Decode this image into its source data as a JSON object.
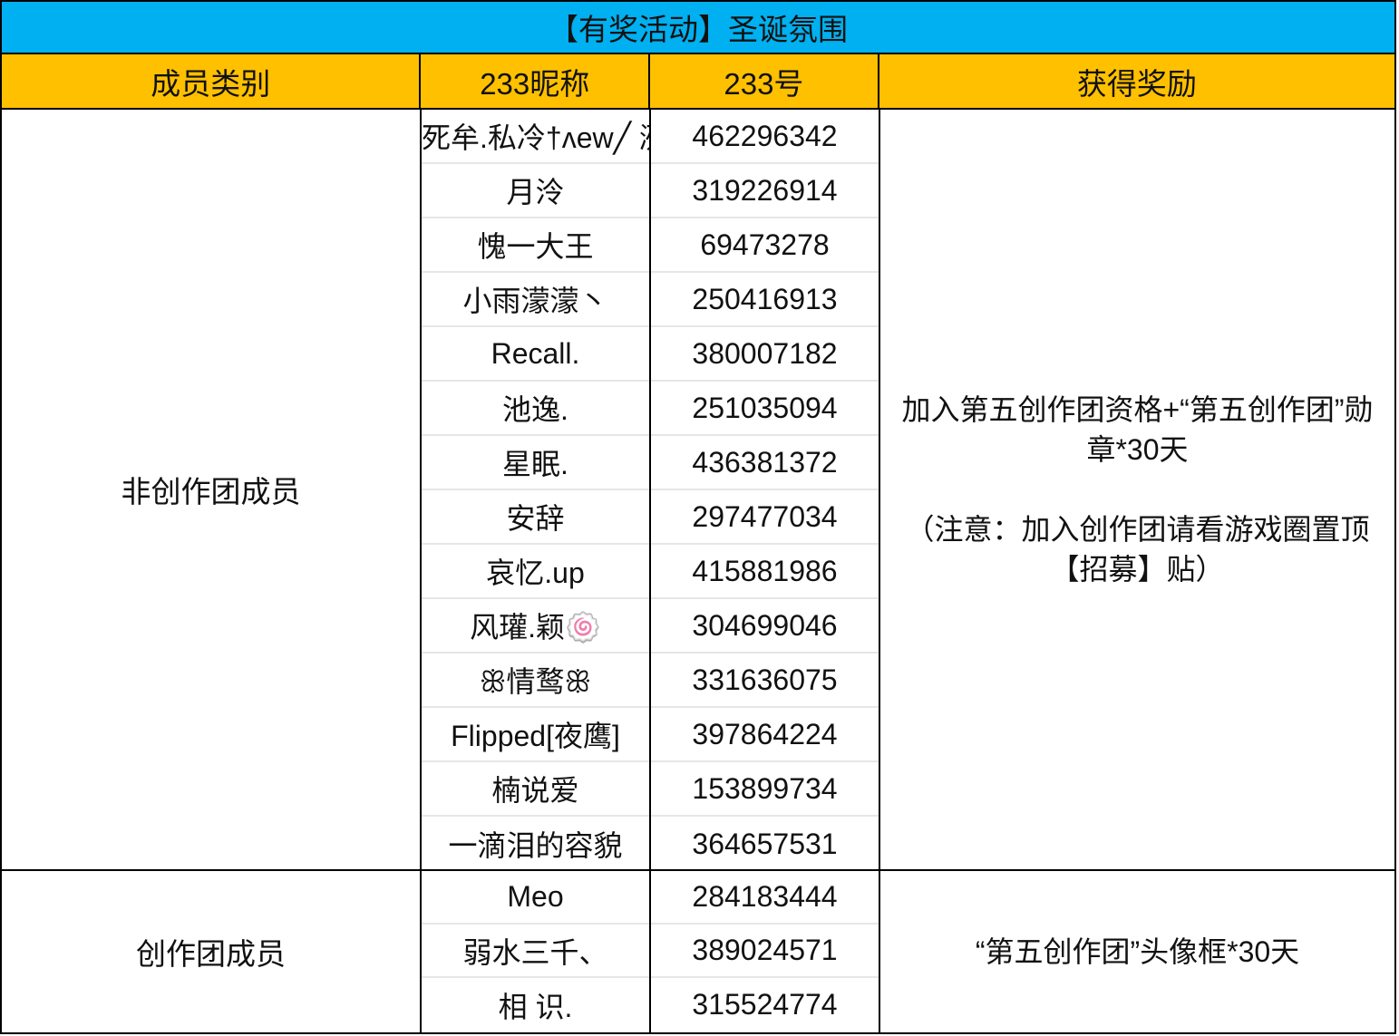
{
  "title": "【有奖活动】圣诞氛围",
  "headers": {
    "category": "成员类别",
    "nickname": "233昵称",
    "id": "233号",
    "reward": "获得奖励"
  },
  "groups": [
    {
      "category": "非创作团成员",
      "reward_line1": "加入第五创作团资格+“第五创作团”勋",
      "reward_line2": "章*30天",
      "note_line1": "（注意：加入创作团请看游戏圈置顶",
      "note_line2": "【招募】贴）",
      "rows": [
        {
          "name": "死牟.私冷†ᴧew╱ 洌",
          "id": "462296342"
        },
        {
          "name": "月泠",
          "id": "319226914"
        },
        {
          "name": "愧一大王",
          "id": "69473278"
        },
        {
          "name": "小雨濛濛丶",
          "id": "250416913"
        },
        {
          "name": "Recall.",
          "id": "380007182"
        },
        {
          "name": "池逸.",
          "id": "251035094"
        },
        {
          "name": "星眠.",
          "id": "436381372"
        },
        {
          "name": "安辞",
          "id": "297477034"
        },
        {
          "name": "哀忆.up",
          "id": "415881986"
        },
        {
          "name": "风瓘.颖🍥",
          "id": "304699046"
        },
        {
          "name": "ꕥ情鹜ꕥ",
          "id": "331636075"
        },
        {
          "name": "Flipped[夜鹰]",
          "id": "397864224"
        },
        {
          "name": "楠说爱",
          "id": "153899734"
        },
        {
          "name": "一滴泪的容貌",
          "id": "364657531"
        }
      ]
    },
    {
      "category": "创作团成员",
      "reward": "“第五创作团”头像框*30天",
      "rows": [
        {
          "name": "Meo",
          "id": "284183444"
        },
        {
          "name": "弱水三千、",
          "id": "389024571"
        },
        {
          "name": "相 识.",
          "id": "315524774"
        }
      ]
    }
  ]
}
